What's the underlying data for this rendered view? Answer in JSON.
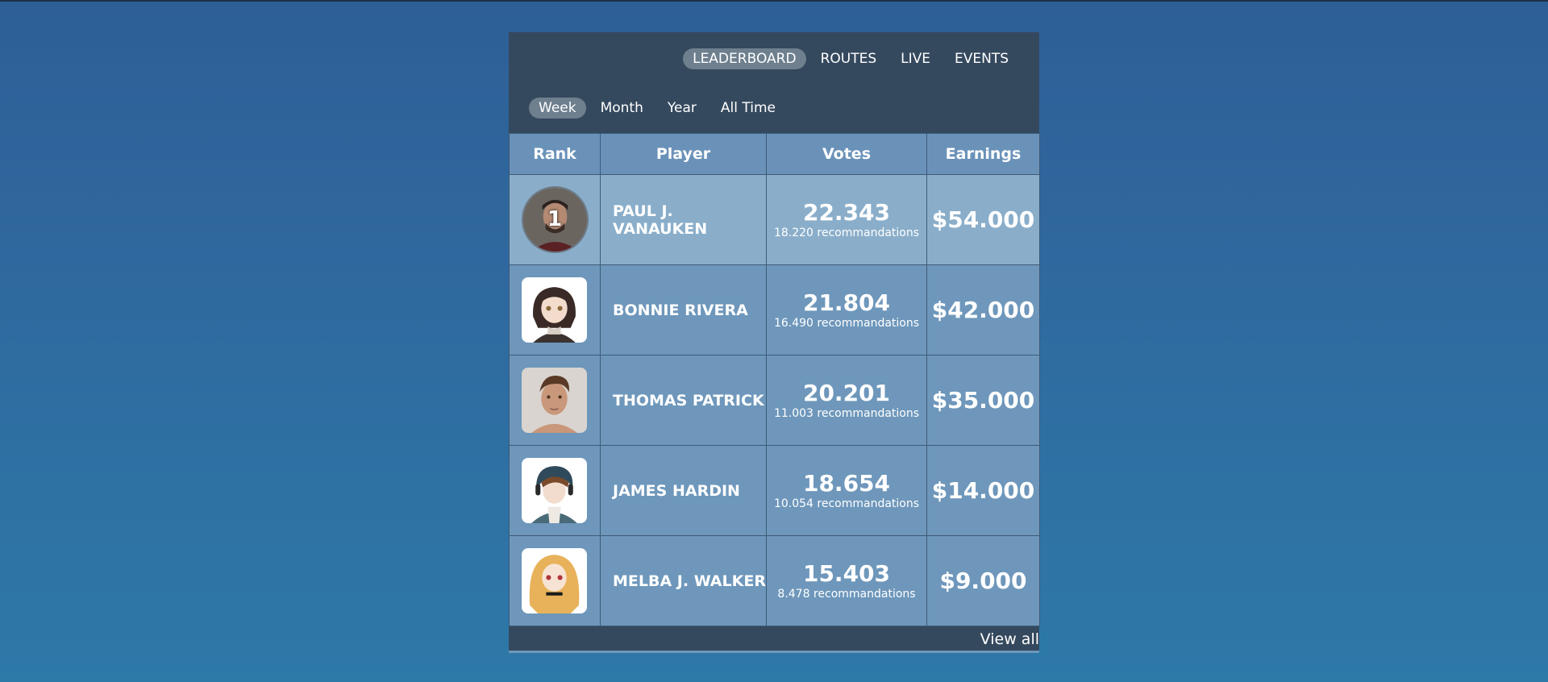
{
  "nav": {
    "items": [
      {
        "label": "LEADERBOARD",
        "active": true
      },
      {
        "label": "ROUTES",
        "active": false
      },
      {
        "label": "LIVE",
        "active": false
      },
      {
        "label": "EVENTS",
        "active": false
      }
    ]
  },
  "periods": {
    "items": [
      {
        "label": "Week",
        "active": true
      },
      {
        "label": "Month",
        "active": false
      },
      {
        "label": "Year",
        "active": false
      },
      {
        "label": "All Time",
        "active": false
      }
    ]
  },
  "table": {
    "headers": {
      "rank": "Rank",
      "player": "Player",
      "votes": "Votes",
      "earnings": "Earnings"
    },
    "rows": [
      {
        "rank": "1",
        "player": "PAUL J. VANAUKEN",
        "votes": "22.343",
        "recommendations": "18.220 recommandations",
        "earnings": "$54.000",
        "avatar_icon": "man-photo-avatar"
      },
      {
        "rank": "",
        "player": "BONNIE RIVERA",
        "votes": "21.804",
        "recommendations": "16.490 recommandations",
        "earnings": "$42.000",
        "avatar_icon": "anime-girl-avatar"
      },
      {
        "rank": "",
        "player": "THOMAS PATRICK",
        "votes": "20.201",
        "recommendations": "11.003 recommandations",
        "earnings": "$35.000",
        "avatar_icon": "man-portrait-avatar"
      },
      {
        "rank": "",
        "player": "JAMES HARDIN",
        "votes": "18.654",
        "recommendations": "10.054 recommandations",
        "earnings": "$14.000",
        "avatar_icon": "anime-boy-avatar"
      },
      {
        "rank": "",
        "player": "MELBA J. WALKER",
        "votes": "15.403",
        "recommendations": "8.478 recommandations",
        "earnings": "$9.000",
        "avatar_icon": "anime-blonde-girl-avatar"
      }
    ]
  },
  "footer": {
    "view_all": "View all"
  },
  "colors": {
    "panel_dark": "#35495e",
    "active_pill": "#6e7f8e",
    "row_highlight": "#8aaeca",
    "row": "#6e97bb"
  }
}
